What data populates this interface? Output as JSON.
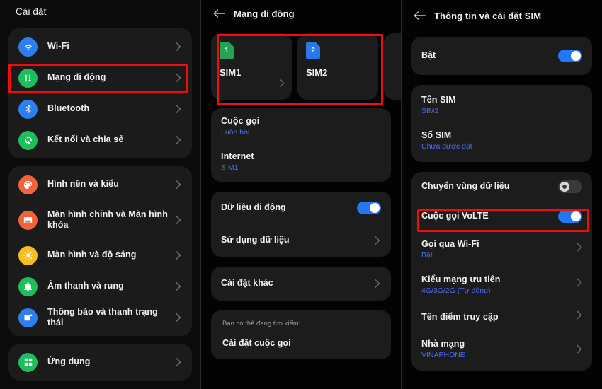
{
  "panels": {
    "left": {
      "header": {
        "title": "Cài đặt"
      },
      "groups": [
        {
          "items": [
            {
              "label": "Wi-Fi",
              "icon": "wifi-icon",
              "color": "#2d7ff0",
              "highlighted": false
            },
            {
              "label": "Mạng di động",
              "icon": "mobile-network-icon",
              "color": "#1dbf5c",
              "highlighted": true
            },
            {
              "label": "Bluetooth",
              "icon": "bluetooth-icon",
              "color": "#2d7ff0",
              "highlighted": false
            },
            {
              "label": "Kết nối và chia sẻ",
              "icon": "connection-share-icon",
              "color": "#1dbf5c",
              "highlighted": false
            }
          ]
        },
        {
          "items": [
            {
              "label": "Hình nền và kiểu",
              "icon": "wallpaper-style-icon",
              "color": "#f4623a",
              "highlighted": false
            },
            {
              "label": "Màn hình chính và Màn hình khóa",
              "icon": "home-lock-screen-icon",
              "color": "#f4623a",
              "highlighted": false
            },
            {
              "label": "Màn hình và độ sáng",
              "icon": "display-brightness-icon",
              "color": "#f5bd1f",
              "highlighted": false
            },
            {
              "label": "Âm thanh và rung",
              "icon": "sound-vibration-icon",
              "color": "#1dbf5c",
              "highlighted": false
            },
            {
              "label": "Thông báo và thanh trạng thái",
              "icon": "notification-statusbar-icon",
              "color": "#2d7ff0",
              "highlighted": false
            }
          ]
        },
        {
          "items": [
            {
              "label": "Ứng dụng",
              "icon": "apps-icon",
              "color": "#1dbf5c",
              "highlighted": false
            }
          ]
        }
      ]
    },
    "middle": {
      "header": {
        "title": "Mạng di động",
        "back_icon": "back-arrow-icon"
      },
      "sim_cards": [
        {
          "name": "SIM1",
          "badge": "1",
          "color": "#23a455"
        },
        {
          "name": "SIM2",
          "badge": "2",
          "color": "#2878e8"
        }
      ],
      "sim_highlight": true,
      "detail_card": [
        {
          "title": "Cuộc gọi",
          "sub": "Luôn hỏi"
        },
        {
          "title": "Internet",
          "sub": "SIM1"
        }
      ],
      "data_card": [
        {
          "title": "Dữ liệu di động",
          "control": "toggle",
          "toggle_on": true
        },
        {
          "title": "Sử dụng dữ liệu",
          "control": "chevron"
        }
      ],
      "more_card": [
        {
          "title": "Cài đặt khác",
          "control": "chevron"
        }
      ],
      "suggestion": {
        "heading": "Bạn có thể đang tìm kiếm:",
        "item": "Cài đặt cuộc gọi"
      }
    },
    "right": {
      "header": {
        "title": "Thông tin và cài đặt SIM",
        "back_icon": "back-arrow-icon"
      },
      "enable_card": [
        {
          "title": "Bật",
          "control": "toggle",
          "toggle_on": true
        }
      ],
      "info_card": [
        {
          "title": "Tên SIM",
          "sub": "SIM2"
        },
        {
          "title": "Số SIM",
          "sub": "Chưa được đặt"
        }
      ],
      "options_card": [
        {
          "title": "Chuyển vùng dữ liệu",
          "control": "toggle",
          "toggle_on": false,
          "highlighted": false
        },
        {
          "title": "Cuộc gọi VoLTE",
          "control": "toggle",
          "toggle_on": true,
          "highlighted": true
        },
        {
          "title": "Gọi qua Wi-Fi",
          "sub": "Bật",
          "control": "chevron",
          "highlighted": false
        },
        {
          "title": "Kiểu mạng ưu tiên",
          "sub": "4G/3G/2G (Tự động)",
          "control": "chevron",
          "highlighted": false
        },
        {
          "title": "Tên điểm truy cập",
          "control": "chevron",
          "highlighted": false
        },
        {
          "title": "Nhà mạng",
          "sub": "VINAPHONE",
          "control": "chevron",
          "highlighted": false
        }
      ]
    }
  },
  "colors": {
    "accent_blue": "#2277f5",
    "sub_blue": "#4a6ef0",
    "highlight_red": "#f20d0d",
    "card_bg": "#1c1c1c",
    "page_bg": "#050505"
  }
}
